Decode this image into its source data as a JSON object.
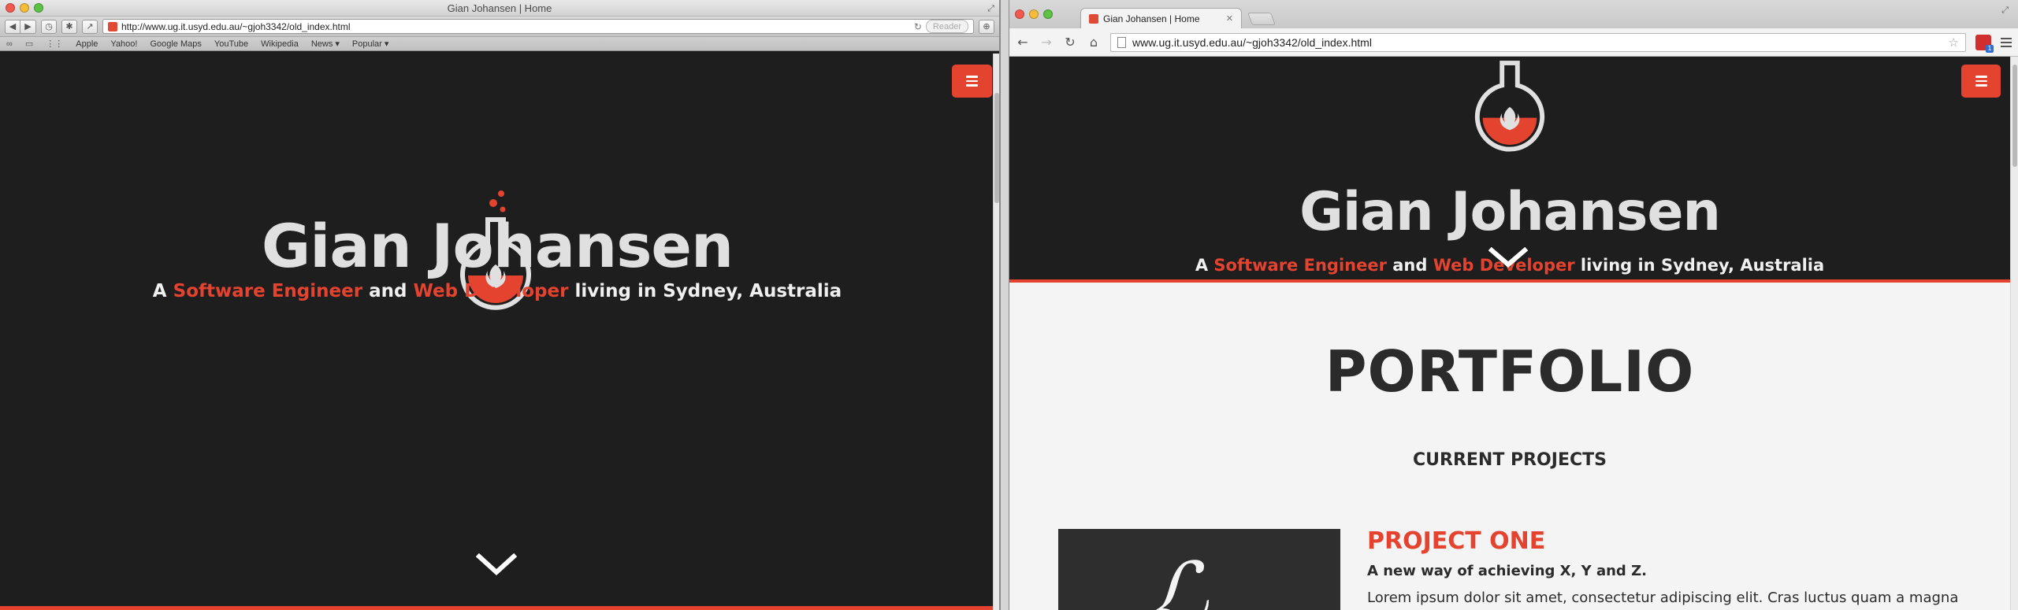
{
  "colors": {
    "accent": "#e3432f",
    "hero_bg": "#1e1e1e",
    "hero_text": "#e0e0e0",
    "page_bg": "#f4f4f4",
    "heading_text": "#2b2b2b"
  },
  "left_window": {
    "browser": "Safari",
    "title": "Gian Johansen | Home",
    "toolbar": {
      "back_icon": "back-arrow-icon",
      "forward_icon": "forward-arrow-icon",
      "url": "http://www.ug.it.usyd.edu.au/~gjoh3342/old_index.html",
      "reader_label": "Reader"
    },
    "bookmarks": [
      "Apple",
      "Yahoo!",
      "Google Maps",
      "YouTube",
      "Wikipedia",
      "News ▾",
      "Popular ▾"
    ],
    "page": {
      "menu_icon": "hamburger-menu-icon",
      "logo_icon": "flask-flame-icon",
      "name": "Gian Johansen",
      "subtitle": {
        "prefix": "A",
        "role1": "Software Engineer",
        "conjunction": "and",
        "role2": "Web Developer",
        "suffix": "living in Sydney, Australia"
      },
      "scroll_icon": "chevron-down-icon"
    }
  },
  "right_window": {
    "browser": "Chrome",
    "tab_title": "Gian Johansen | Home",
    "url": "www.ug.it.usyd.edu.au/~gjoh3342/old_index.html",
    "page": {
      "menu_icon": "hamburger-menu-icon",
      "logo_icon": "flask-flame-icon",
      "name": "Gian Johansen",
      "subtitle": {
        "prefix": "A",
        "role1": "Software Engineer",
        "conjunction": "and",
        "role2": "Web Developer",
        "suffix": "living in Sydney, Australia"
      },
      "section_title": "PORTFOLIO",
      "section_subtitle": "CURRENT PROJECTS",
      "project": {
        "name": "PROJECT ONE",
        "tagline": "A new way of achieving X, Y and Z.",
        "body": "Lorem ipsum dolor sit amet, consectetur adipiscing elit. Cras luctus quam a magna"
      }
    }
  }
}
